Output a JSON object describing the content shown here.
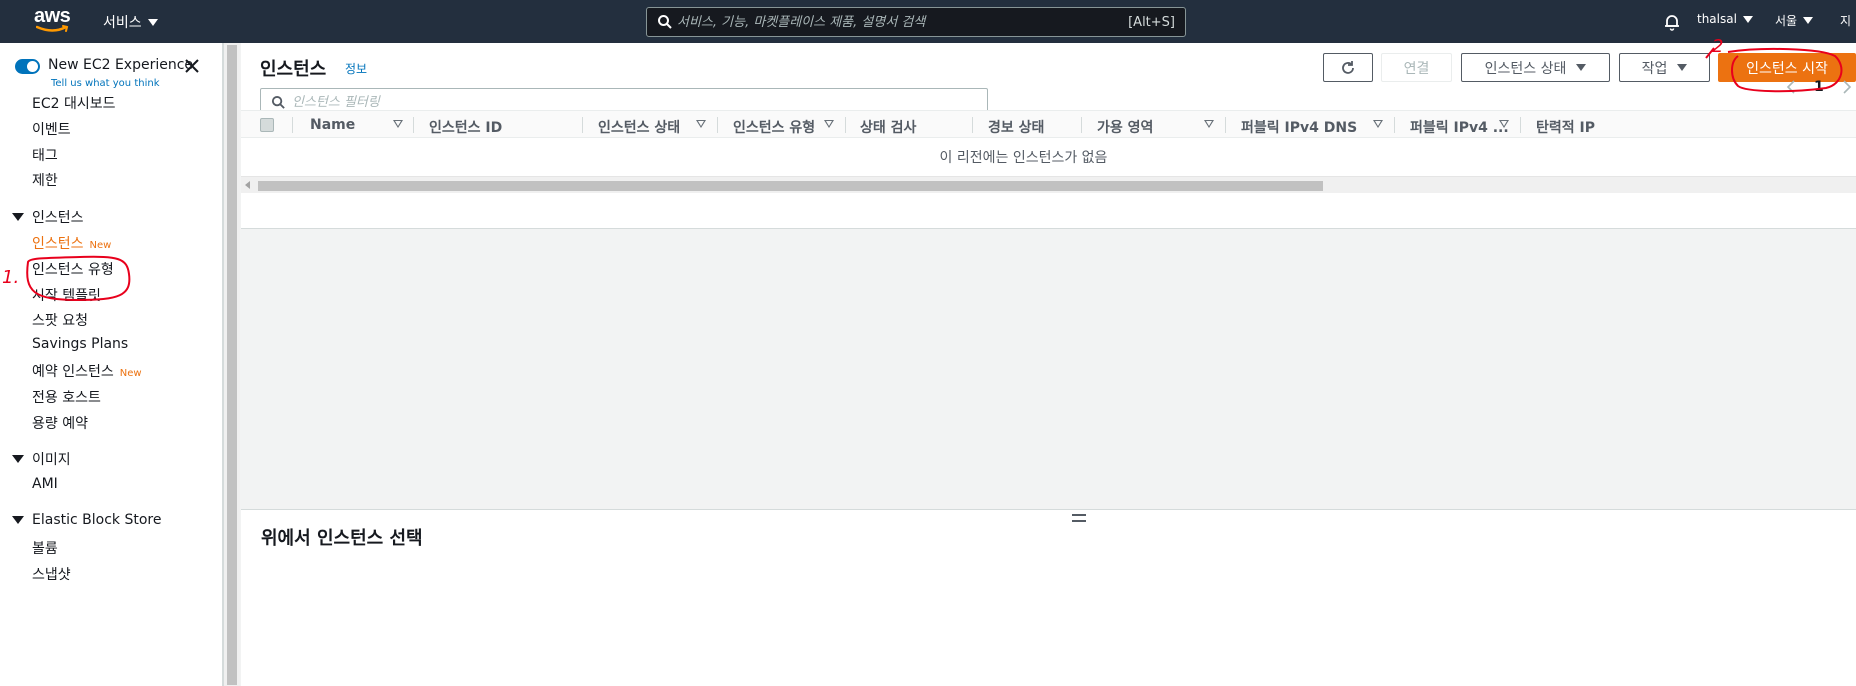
{
  "topnav": {
    "logo_text": "aws",
    "services_label": "서비스",
    "search_placeholder": "서비스, 기능, 마켓플레이스 제품, 설명서 검색",
    "search_shortcut": "[Alt+S]",
    "account": "thalsal",
    "region": "서울",
    "support_partial": "지"
  },
  "sidebar": {
    "new_experience": "New EC2 Experience",
    "tell_us": "Tell us what you think",
    "top_items": [
      "EC2 대시보드",
      "이벤트",
      "태그",
      "제한"
    ],
    "sections": [
      {
        "title": "인스턴스",
        "items": [
          {
            "label": "인스턴스",
            "badge": "New",
            "active": true
          },
          {
            "label": "인스턴스 유형",
            "badge": "",
            "active": false
          },
          {
            "label": "시작 템플릿",
            "badge": "",
            "active": false
          },
          {
            "label": "스팟 요청",
            "badge": "",
            "active": false
          },
          {
            "label": "Savings Plans",
            "badge": "",
            "active": false
          },
          {
            "label": "예약 인스턴스",
            "badge": "New",
            "active": false
          },
          {
            "label": "전용 호스트",
            "badge": "",
            "active": false
          },
          {
            "label": "용량 예약",
            "badge": "",
            "active": false
          }
        ]
      },
      {
        "title": "이미지",
        "items": [
          {
            "label": "AMI",
            "badge": "",
            "active": false
          }
        ]
      },
      {
        "title": "Elastic Block Store",
        "items": [
          {
            "label": "볼륨",
            "badge": "",
            "active": false
          },
          {
            "label": "스냅샷",
            "badge": "",
            "active": false
          }
        ]
      }
    ]
  },
  "main": {
    "title": "인스턴스",
    "info_link": "정보",
    "buttons": {
      "connect": "연결",
      "instance_state": "인스턴스 상태",
      "actions": "작업",
      "launch": "인스턴스 시작"
    },
    "filter_placeholder": "인스턴스 필터링",
    "page_number": "1",
    "columns": [
      "Name",
      "인스턴스 ID",
      "인스턴스 상태",
      "인스턴스 유형",
      "상태 검사",
      "경보 상태",
      "가용 영역",
      "퍼블릭 IPv4 DNS",
      "퍼블릭 IPv4 ...",
      "탄력적 IP"
    ],
    "empty_message": "이 리전에는 인스턴스가 없음"
  },
  "bottom": {
    "title": "위에서 인스턴스 선택"
  },
  "annotations": {
    "step1": "1.",
    "step2": "2"
  },
  "colors": {
    "nav_bg": "#232f3e",
    "accent_orange": "#ec7211",
    "link_blue": "#0073bb",
    "annotation_red": "#e8001c"
  }
}
